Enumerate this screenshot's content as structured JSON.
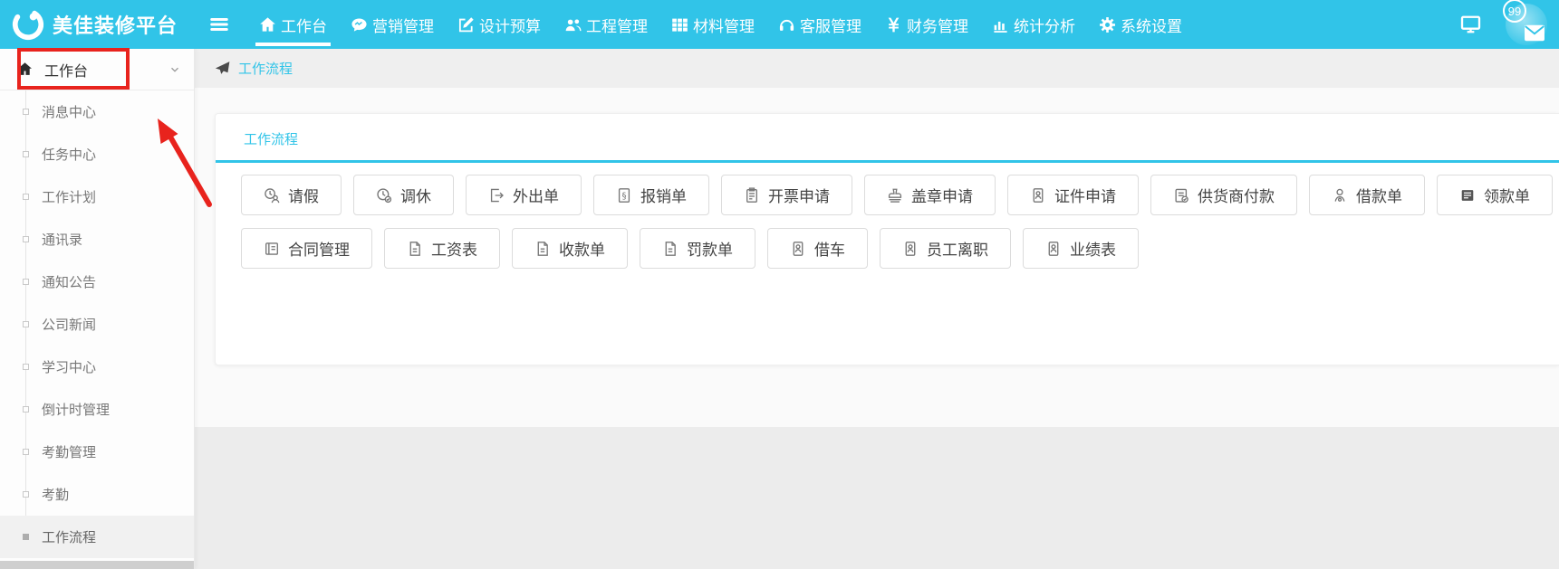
{
  "colors": {
    "primary": "#31c4e8",
    "annotation": "#e8231d"
  },
  "navbar": {
    "brand": "美佳装修平台",
    "badge_count": "99",
    "items": [
      {
        "name": "workbench",
        "icon": "home-icon",
        "label": "工作台",
        "active": true
      },
      {
        "name": "marketing",
        "icon": "comments-icon",
        "label": "营销管理",
        "active": false
      },
      {
        "name": "design-budget",
        "icon": "edit-icon",
        "label": "设计预算",
        "active": false
      },
      {
        "name": "engineering",
        "icon": "users-icon",
        "label": "工程管理",
        "active": false
      },
      {
        "name": "materials",
        "icon": "grid-icon",
        "label": "材料管理",
        "active": false
      },
      {
        "name": "customer-service",
        "icon": "headset-icon",
        "label": "客服管理",
        "active": false
      },
      {
        "name": "finance",
        "icon": "yen-icon",
        "label": "财务管理",
        "active": false
      },
      {
        "name": "statistics",
        "icon": "chart-icon",
        "label": "统计分析",
        "active": false
      },
      {
        "name": "system-settings",
        "icon": "gear-icon",
        "label": "系统设置",
        "active": false
      }
    ]
  },
  "sidebar": {
    "root_label": "工作台",
    "items": [
      {
        "name": "message-center",
        "label": "消息中心",
        "active": false
      },
      {
        "name": "task-center",
        "label": "任务中心",
        "active": false
      },
      {
        "name": "work-plan",
        "label": "工作计划",
        "active": false
      },
      {
        "name": "contacts",
        "label": "通讯录",
        "active": false
      },
      {
        "name": "notice-announcement",
        "label": "通知公告",
        "active": false
      },
      {
        "name": "company-news",
        "label": "公司新闻",
        "active": false
      },
      {
        "name": "learning-center",
        "label": "学习中心",
        "active": false
      },
      {
        "name": "countdown-mgmt",
        "label": "倒计时管理",
        "active": false
      },
      {
        "name": "attendance-mgmt",
        "label": "考勤管理",
        "active": false
      },
      {
        "name": "attendance",
        "label": "考勤",
        "active": false
      },
      {
        "name": "workflow",
        "label": "工作流程",
        "active": true
      }
    ]
  },
  "breadcrumb": {
    "label": "工作流程"
  },
  "main": {
    "tab_label": "工作流程",
    "button_rows": [
      [
        {
          "name": "leave-request",
          "icon": "user-clock-icon",
          "label": "请假"
        },
        {
          "name": "comp-leave",
          "icon": "clock-check-icon",
          "label": "调休"
        },
        {
          "name": "outing-form",
          "icon": "sign-out-icon",
          "label": "外出单"
        },
        {
          "name": "reimbursement-form",
          "icon": "file-invoice-icon",
          "label": "报销单"
        },
        {
          "name": "invoice-request",
          "icon": "clipboard-icon",
          "label": "开票申请"
        },
        {
          "name": "seal-request",
          "icon": "stamp-icon",
          "label": "盖章申请"
        },
        {
          "name": "certificate-request",
          "icon": "id-badge-icon",
          "label": "证件申请"
        },
        {
          "name": "supplier-payment",
          "icon": "clipboard-check-icon",
          "label": "供货商付款"
        },
        {
          "name": "loan-form",
          "icon": "user-coin-icon",
          "label": "借款单"
        },
        {
          "name": "payment-claim-form",
          "icon": "table-icon",
          "label": "领款单"
        }
      ],
      [
        {
          "name": "contract-mgmt",
          "icon": "book-icon",
          "label": "合同管理"
        },
        {
          "name": "payroll-sheet",
          "icon": "file-icon",
          "label": "工资表"
        },
        {
          "name": "receipt-form",
          "icon": "file-icon",
          "label": "收款单"
        },
        {
          "name": "fine-form",
          "icon": "file-icon",
          "label": "罚款单"
        },
        {
          "name": "car-borrow",
          "icon": "id-badge-icon",
          "label": "借车"
        },
        {
          "name": "employee-resignation",
          "icon": "id-badge-icon",
          "label": "员工离职"
        },
        {
          "name": "performance-sheet",
          "icon": "id-badge-icon",
          "label": "业绩表"
        }
      ]
    ]
  }
}
